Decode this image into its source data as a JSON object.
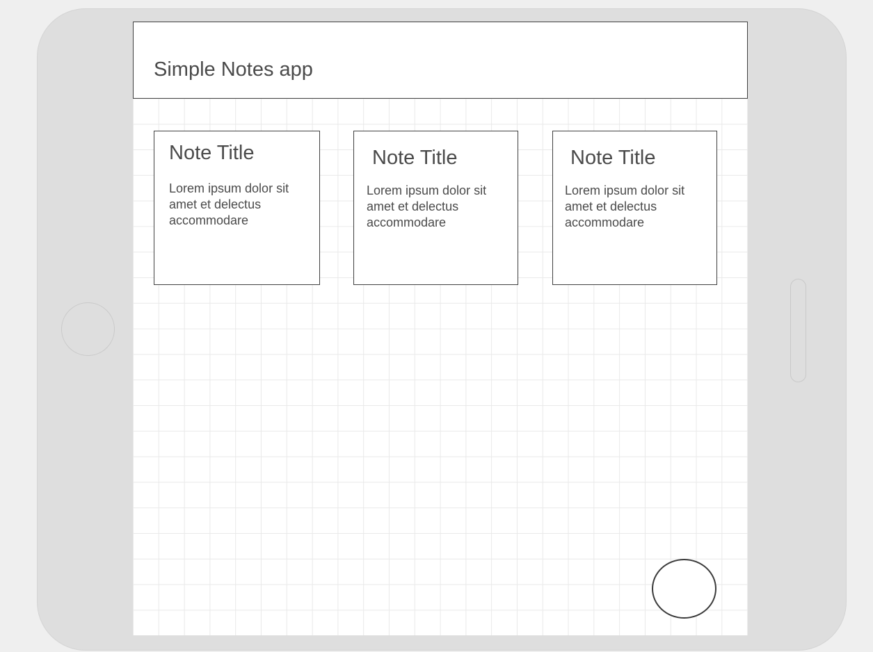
{
  "header": {
    "title": "Simple Notes app"
  },
  "notes": [
    {
      "title": "Note Title",
      "body": "Lorem ipsum dolor sit amet et delectus accommodare"
    },
    {
      "title": "Note Title",
      "body": "Lorem ipsum dolor sit amet et delectus accommodare"
    },
    {
      "title": "Note Title",
      "body": "Lorem ipsum dolor sit amet et delectus accommodare"
    }
  ],
  "fab": {
    "icon": "circle-button"
  },
  "colors": {
    "device_frame": "#dedede",
    "screen_background": "#ffffff",
    "grid_line": "#e9e9e9",
    "border": "#3f3f3f",
    "text": "#4a4a4a"
  }
}
